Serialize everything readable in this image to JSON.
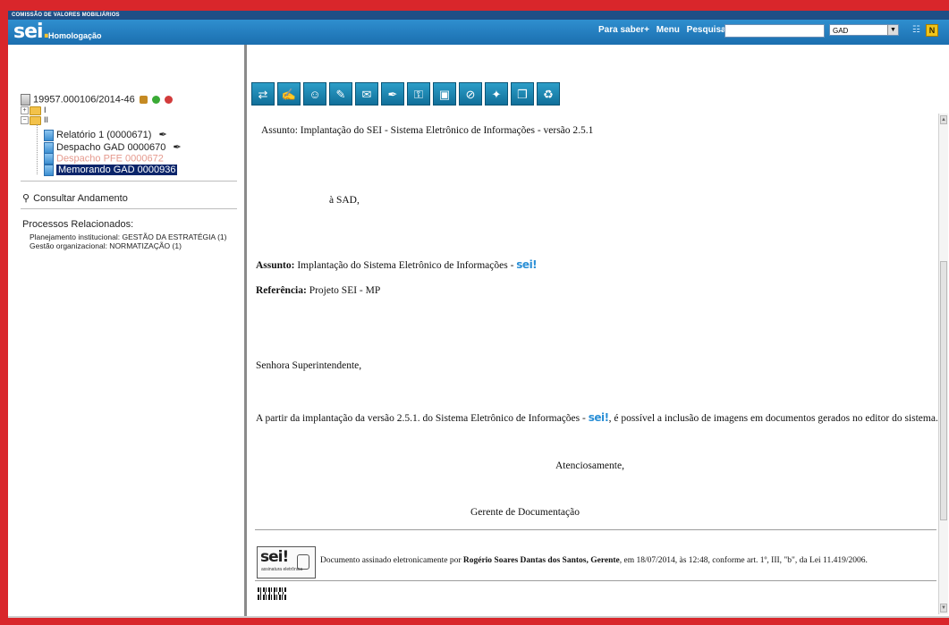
{
  "header": {
    "org": "COMISSÃO DE VALORES MOBILIÁRIOS",
    "logo": "sei",
    "environment": "Homologação",
    "links": [
      "Para saber+",
      "Menu",
      "Pesquisa"
    ],
    "search_value": "",
    "unit_selected": "GAD",
    "icons": [
      "list-icon",
      "notes-icon"
    ]
  },
  "tree": {
    "process_number": "19957.000106/2014-46",
    "folder1": "I",
    "folder2": "II",
    "documents": [
      {
        "label": "Relatório 1 (0000671)",
        "signed": true
      },
      {
        "label": "Despacho GAD 0000670",
        "signed": true
      },
      {
        "label": "Despacho PFE 0000672",
        "signed": false,
        "muted": true
      },
      {
        "label": "Memorando GAD 0000936",
        "signed": false,
        "selected": true
      }
    ],
    "consult_link": "Consultar Andamento",
    "related_title": "Processos Relacionados:",
    "related": [
      "Planejamento institucional: GESTÃO DA ESTRATÉGIA (1)",
      "Gestão organizacional: NORMATIZAÇÃO (1)"
    ]
  },
  "toolbar": {
    "icons": [
      "send-process-icon",
      "sign-icon",
      "users-icon",
      "edit-document-icon",
      "email-icon",
      "pen-icon",
      "auth-icon",
      "sign-block-icon",
      "cancel-icon",
      "new-doc-icon",
      "copy-icon",
      "delete-icon"
    ]
  },
  "document": {
    "subject_top": "Assunto: Implantação do SEI - Sistema Eletrônico de Informações - versão 2.5.1",
    "to": "à SAD,",
    "assunto_label": "Assunto:",
    "assunto_text": "Implantação do Sistema Eletrônico de Informações -",
    "sei_mark": "sei!",
    "referencia_label": "Referência:",
    "referencia_text": "Projeto SEI - MP",
    "salutation": "Senhora Superintendente,",
    "body_pre": "A partir da implantação da versão 2.5.1. do Sistema Eletrônico de Informações -",
    "body_post": ", é possível a inclusão de imagens em documentos gerados no editor do sistema.",
    "closing": "Atenciosamente,",
    "signer_role": "Gerente de Documentação",
    "signature_pre": "Documento assinado eletronicamente por",
    "signature_name": "Rogério Soares Dantas dos Santos, Gerente",
    "signature_post": ", em 18/07/2014, às 12:48, conforme art. 1º, III, \"b\", da Lei 11.419/2006.",
    "stamp_logo": "sei!",
    "stamp_sub": "assinatura eletrônica"
  }
}
